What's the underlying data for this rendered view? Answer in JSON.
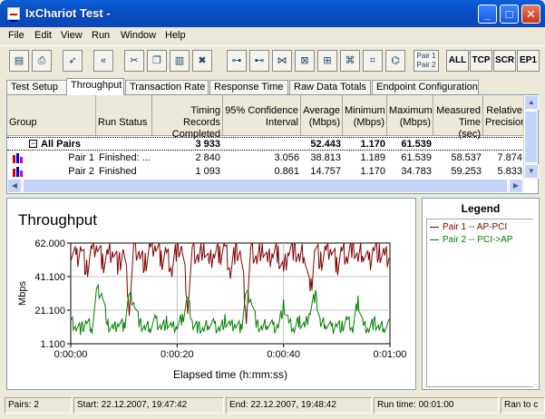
{
  "window": {
    "title": "IxChariot Test -"
  },
  "menu": [
    "File",
    "Edit",
    "View",
    "Run",
    "Window",
    "Help"
  ],
  "toolbar": {
    "pair_button": [
      "Pair 1",
      "Pair 2"
    ],
    "text_buttons": [
      "ALL",
      "TCP",
      "SCR",
      "EP1"
    ]
  },
  "tabs": [
    "Test Setup",
    "Throughput",
    "Transaction Rate",
    "Response Time",
    "Raw Data Totals",
    "Endpoint Configuration"
  ],
  "active_tab": "Throughput",
  "grid": {
    "headers": {
      "group": "Group",
      "run_status": "Run Status",
      "timing_1": "Timing Records",
      "timing_2": "Completed",
      "conf_1": "95% Confidence",
      "conf_2": "Interval",
      "avg_1": "Average",
      "avg_2": "(Mbps)",
      "min_1": "Minimum",
      "min_2": "(Mbps)",
      "max_1": "Maximum",
      "max_2": "(Mbps)",
      "meas_1": "Measured",
      "meas_2": "Time (sec)",
      "rel_1": "Relative",
      "rel_2": "Precision"
    },
    "all_pairs": {
      "label": "All Pairs",
      "records": "3 933",
      "average": "52.443",
      "minimum": "1.170",
      "maximum": "61.539"
    },
    "rows": [
      {
        "group": "Pair 1",
        "status": "Finished: ...",
        "records": "2 840",
        "confidence": "3.056",
        "average": "38.813",
        "minimum": "1.189",
        "maximum": "61.539",
        "measured": "58.537",
        "precision": "7.874"
      },
      {
        "group": "Pair 2",
        "status": "Finished",
        "records": "1 093",
        "confidence": "0.861",
        "average": "14.757",
        "minimum": "1.170",
        "maximum": "34.783",
        "measured": "59.253",
        "precision": "5.833"
      }
    ]
  },
  "chart_data": {
    "type": "line",
    "title": "Throughput",
    "xlabel": "Elapsed time (h:mm:ss)",
    "ylabel": "Mbps",
    "ylim": [
      1.1,
      62.0
    ],
    "yticks": [
      "62.000",
      "41.100",
      "21.100",
      "1.100"
    ],
    "xticks": [
      "0:00:00",
      "0:00:20",
      "0:00:40",
      "0:01:00"
    ],
    "xlim_seconds": [
      0,
      60
    ],
    "series": [
      {
        "name": "Pair 1 -- AP-PCI",
        "color": "#800000",
        "x": [
          0,
          1,
          2,
          3,
          4,
          5,
          6,
          7,
          8,
          9,
          10,
          11,
          12,
          13,
          14,
          15,
          16,
          17,
          18,
          19,
          20,
          21,
          22,
          23,
          24,
          25,
          26,
          27,
          28,
          29,
          30,
          31,
          32,
          33,
          34,
          35,
          36,
          37,
          38,
          39,
          40,
          41,
          42,
          43,
          44,
          45,
          46,
          47,
          48,
          49,
          50,
          51,
          52,
          53,
          54,
          55,
          56,
          57,
          58,
          59
        ],
        "y": [
          58,
          52,
          60,
          45,
          57,
          61,
          50,
          55,
          59,
          48,
          57,
          25,
          60,
          55,
          49,
          58,
          61,
          52,
          56,
          47,
          60,
          57,
          26,
          58,
          53,
          61,
          48,
          57,
          55,
          60,
          46,
          58,
          54,
          20,
          59,
          52,
          61,
          49,
          57,
          55,
          45,
          60,
          58,
          52,
          57,
          30,
          61,
          50,
          56,
          59,
          48,
          57,
          55,
          61,
          52,
          58,
          49,
          60,
          56,
          53
        ]
      },
      {
        "name": "Pair 2 -- PCI->AP",
        "color": "#008000",
        "x": [
          0,
          1,
          2,
          3,
          4,
          5,
          6,
          7,
          8,
          9,
          10,
          11,
          12,
          13,
          14,
          15,
          16,
          17,
          18,
          19,
          20,
          21,
          22,
          23,
          24,
          25,
          26,
          27,
          28,
          29,
          30,
          31,
          32,
          33,
          34,
          35,
          36,
          37,
          38,
          39,
          40,
          41,
          42,
          43,
          44,
          45,
          46,
          47,
          48,
          49,
          50,
          51,
          52,
          53,
          54,
          55,
          56,
          57,
          58,
          59
        ],
        "y": [
          15,
          12,
          10,
          14,
          11,
          34,
          30,
          12,
          9,
          14,
          11,
          31,
          26,
          13,
          10,
          12,
          15,
          11,
          14,
          10,
          12,
          16,
          29,
          13,
          11,
          9,
          14,
          12,
          10,
          15,
          11,
          13,
          10,
          32,
          28,
          12,
          10,
          14,
          11,
          12,
          24,
          13,
          10,
          15,
          11,
          22,
          31,
          12,
          14,
          10,
          13,
          11,
          15,
          10,
          27,
          12,
          11,
          14,
          10,
          12
        ]
      }
    ]
  },
  "legend": {
    "title": "Legend"
  },
  "statusbar": {
    "pairs": "Pairs: 2",
    "start": "Start: 22.12.2007, 19:47:42",
    "end": "End: 22.12.2007, 19:48:42",
    "runtime": "Run time: 00:01:00",
    "ran": "Ran to c"
  }
}
